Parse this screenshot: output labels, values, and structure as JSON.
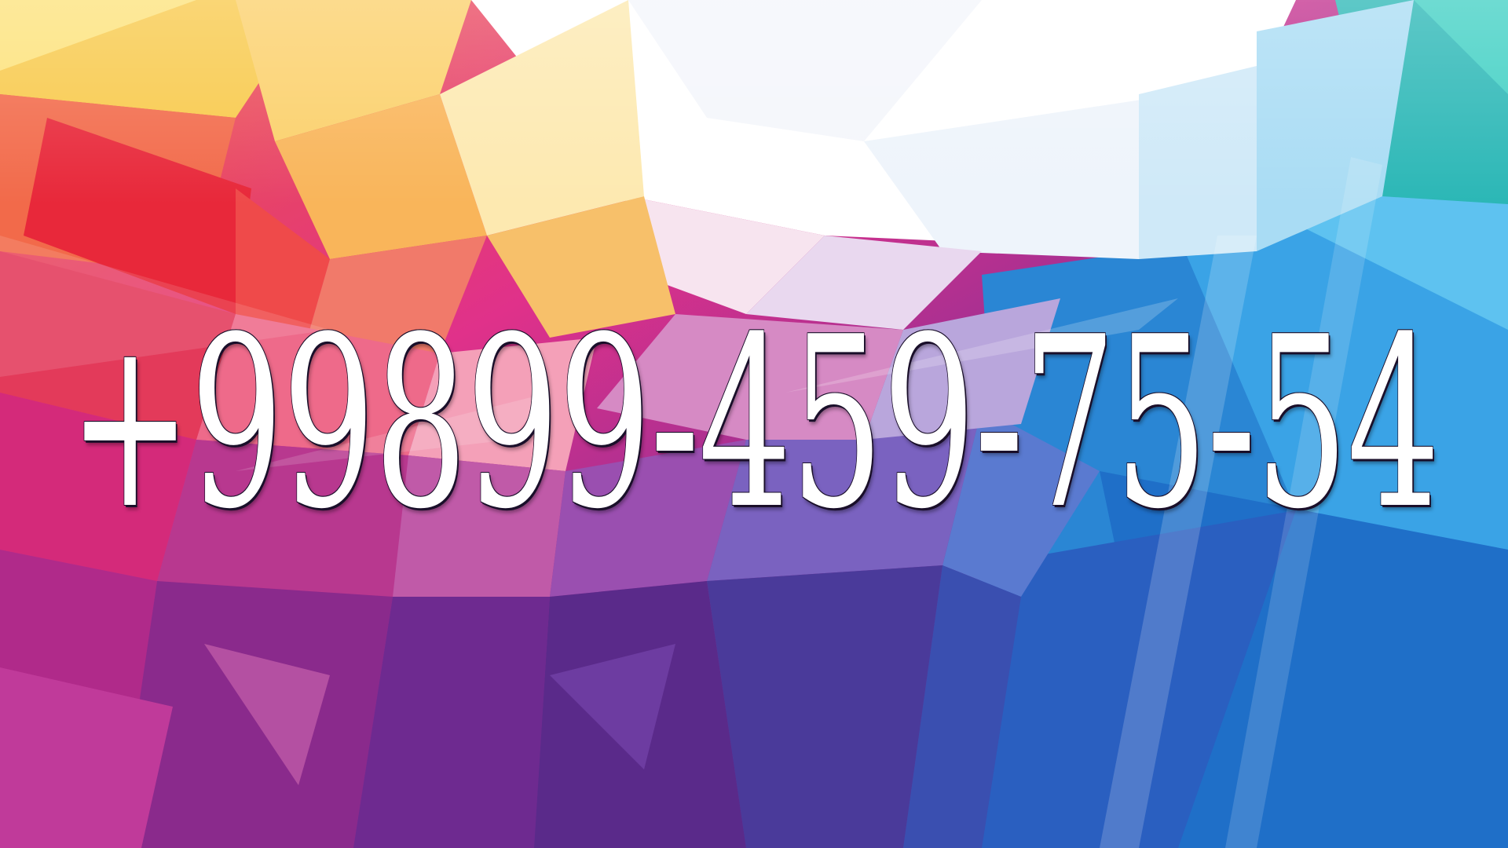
{
  "background": {
    "description_icon": "low-poly-gradient-background",
    "colors": {
      "red": "#e8283a",
      "orange": "#f6a24a",
      "yellow": "#f8d64a",
      "white": "#ffffff",
      "pink": "#e23a8e",
      "magenta": "#c7328f",
      "purple": "#6a2a9a",
      "deep_purple": "#4a1f7a",
      "blue": "#2a8ad6",
      "light_blue": "#5ab9ea",
      "cyan": "#1fb5b0"
    }
  },
  "phone": {
    "text": "+99899-459-75-54"
  }
}
